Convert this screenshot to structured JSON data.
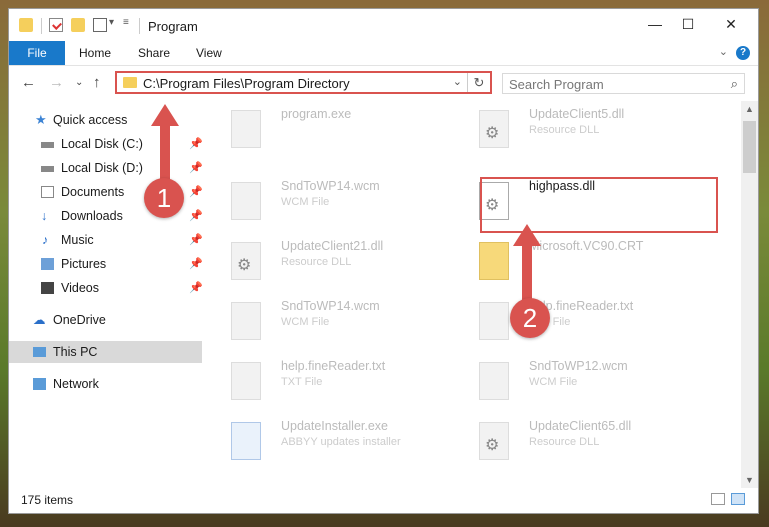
{
  "window": {
    "title": "Program"
  },
  "ribbon": {
    "file": "File",
    "home": "Home",
    "share": "Share",
    "view": "View",
    "help": "?"
  },
  "address": {
    "path": "C:\\Program Files\\Program Directory",
    "search_placeholder": "Search Program"
  },
  "nav": {
    "quick_access": "Quick access",
    "items": [
      {
        "label": "Local Disk (C:)"
      },
      {
        "label": "Local Disk (D:)"
      },
      {
        "label": "Documents"
      },
      {
        "label": "Downloads"
      },
      {
        "label": "Music"
      },
      {
        "label": "Pictures"
      },
      {
        "label": "Videos"
      }
    ],
    "onedrive": "OneDrive",
    "this_pc": "This PC",
    "network": "Network"
  },
  "files": [
    {
      "name": "program.exe",
      "type": ""
    },
    {
      "name": "UpdateClient5.dll",
      "type": "Resource DLL"
    },
    {
      "name": "SndToWP14.wcm",
      "type": "WCM File"
    },
    {
      "name": "highpass.dll",
      "type": ""
    },
    {
      "name": "UpdateClient21.dll",
      "type": "Resource DLL"
    },
    {
      "name": "Microsoft.VC90.CRT",
      "type": ""
    },
    {
      "name": "SndToWP14.wcm",
      "type": "WCM File"
    },
    {
      "name": "help.fineReader.txt",
      "type": "TXT File"
    },
    {
      "name": "help.fineReader.txt",
      "type": "TXT File"
    },
    {
      "name": "SndToWP12.wcm",
      "type": "WCM File"
    },
    {
      "name": "UpdateInstaller.exe",
      "type": "ABBYY updates installer"
    },
    {
      "name": "UpdateClient65.dll",
      "type": "Resource DLL"
    }
  ],
  "status": {
    "count": "175 items"
  },
  "annotations": {
    "one": "1",
    "two": "2"
  },
  "colors": {
    "accent": "#1979ca",
    "highlight": "#d9534f"
  }
}
